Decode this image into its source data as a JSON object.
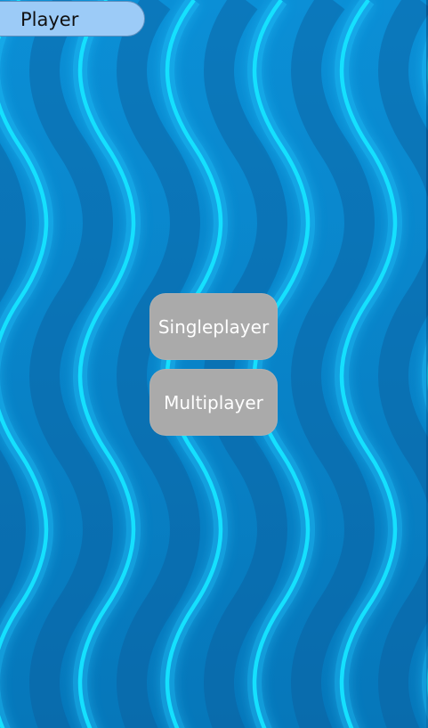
{
  "header": {
    "tab_label": "Player"
  },
  "menu": {
    "singleplayer_label": "Singleplayer",
    "multiplayer_label": "Multiplayer"
  },
  "theme": {
    "background": "#0a7cc4",
    "wave_color": "#18d8ff",
    "button_color": "#aaaaaa",
    "tab_color": "#9ccbf7"
  },
  "icons": {
    "background_pattern": "wave-pattern-icon"
  }
}
